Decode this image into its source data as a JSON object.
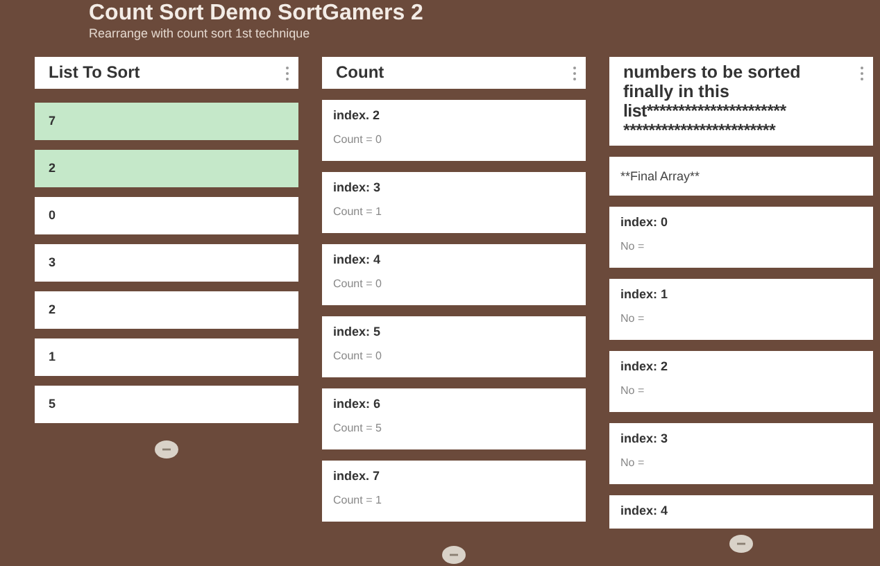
{
  "header": {
    "title": "Count Sort Demo SortGamers 2",
    "subtitle": "Rearrange with count sort 1st technique"
  },
  "columns": [
    {
      "kind": "list",
      "title": "List To Sort",
      "items": [
        {
          "label": "7",
          "selected": true
        },
        {
          "label": "2",
          "selected": true
        },
        {
          "label": "0",
          "selected": false
        },
        {
          "label": "3",
          "selected": false
        },
        {
          "label": "2",
          "selected": false
        },
        {
          "label": "1",
          "selected": false
        },
        {
          "label": "5",
          "selected": false
        }
      ]
    },
    {
      "kind": "cards",
      "title": "Count",
      "cards": [
        {
          "heading": "index. 2",
          "detail": "Count = 0"
        },
        {
          "heading": "index: 3",
          "detail": "Count = 1"
        },
        {
          "heading": "index: 4",
          "detail": "Count = 0"
        },
        {
          "heading": "index: 5",
          "detail": "Count = 0"
        },
        {
          "heading": "index: 6",
          "detail": "Count = 5"
        },
        {
          "heading": "index. 7",
          "detail": "Count = 1"
        }
      ]
    },
    {
      "kind": "cards",
      "title_lines": [
        "numbers to be sorted",
        "finally in this",
        "list**********************",
        "************************"
      ],
      "subtitle": "**Final Array**",
      "cards": [
        {
          "heading": "index: 0",
          "detail": "No ="
        },
        {
          "heading": "index: 1",
          "detail": "No ="
        },
        {
          "heading": "index: 2",
          "detail": "No ="
        },
        {
          "heading": "index: 3",
          "detail": "No ="
        },
        {
          "heading": "index: 4"
        }
      ]
    }
  ]
}
